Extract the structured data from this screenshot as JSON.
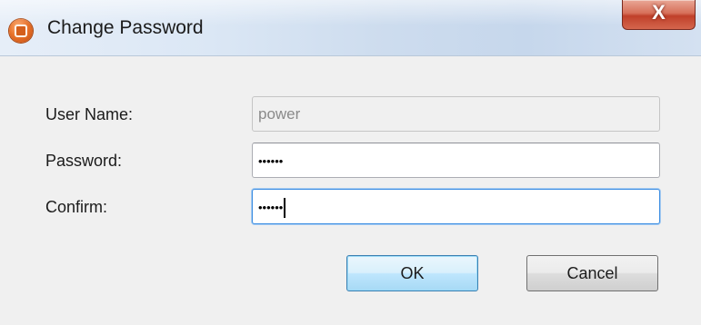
{
  "window": {
    "title": "Change Password",
    "close_label": "X"
  },
  "form": {
    "username": {
      "label": "User Name:",
      "value": "power",
      "disabled": true
    },
    "password": {
      "label": "Password:",
      "value": "••••••"
    },
    "confirm": {
      "label": "Confirm:",
      "value": "••••••"
    }
  },
  "buttons": {
    "ok": "OK",
    "cancel": "Cancel"
  },
  "icons": {
    "app": "lifebuoy-icon",
    "close": "close-icon"
  },
  "colors": {
    "default_button_border": "#3c7fb1",
    "close_button": "#c0402a",
    "disabled_text": "#8a8a8a"
  }
}
